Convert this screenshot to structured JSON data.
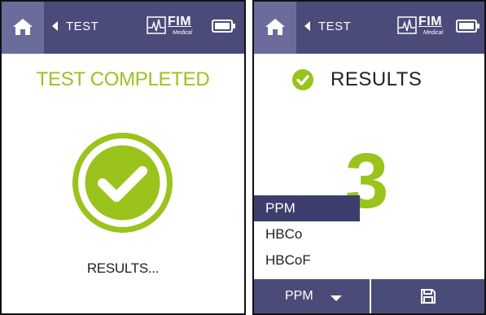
{
  "screen1": {
    "header": {
      "back_label": "TEST",
      "logo_text": "FIM",
      "logo_sub": "Medical"
    },
    "title": "TEST COMPLETED",
    "status": "RESULTS..."
  },
  "screen2": {
    "header": {
      "back_label": "TEST",
      "logo_text": "FIM",
      "logo_sub": "Medical"
    },
    "title": "RESULTS",
    "value": "3",
    "unit_menu": {
      "options": [
        "PPM",
        "HBCo",
        "HBCoF"
      ],
      "selected": "PPM"
    },
    "bottom_bar": {
      "unit_button_label": "PPM"
    }
  },
  "colors": {
    "accent": "#9ac31c",
    "header": "#4b4b7a",
    "home_tile": "#6c6c9c",
    "menu_selected": "#3e3e6e"
  },
  "icons": [
    "home-icon",
    "back-arrow-icon",
    "fim-logo-icon",
    "battery-icon",
    "check-circle-icon",
    "save-icon",
    "chevron-down-icon"
  ]
}
